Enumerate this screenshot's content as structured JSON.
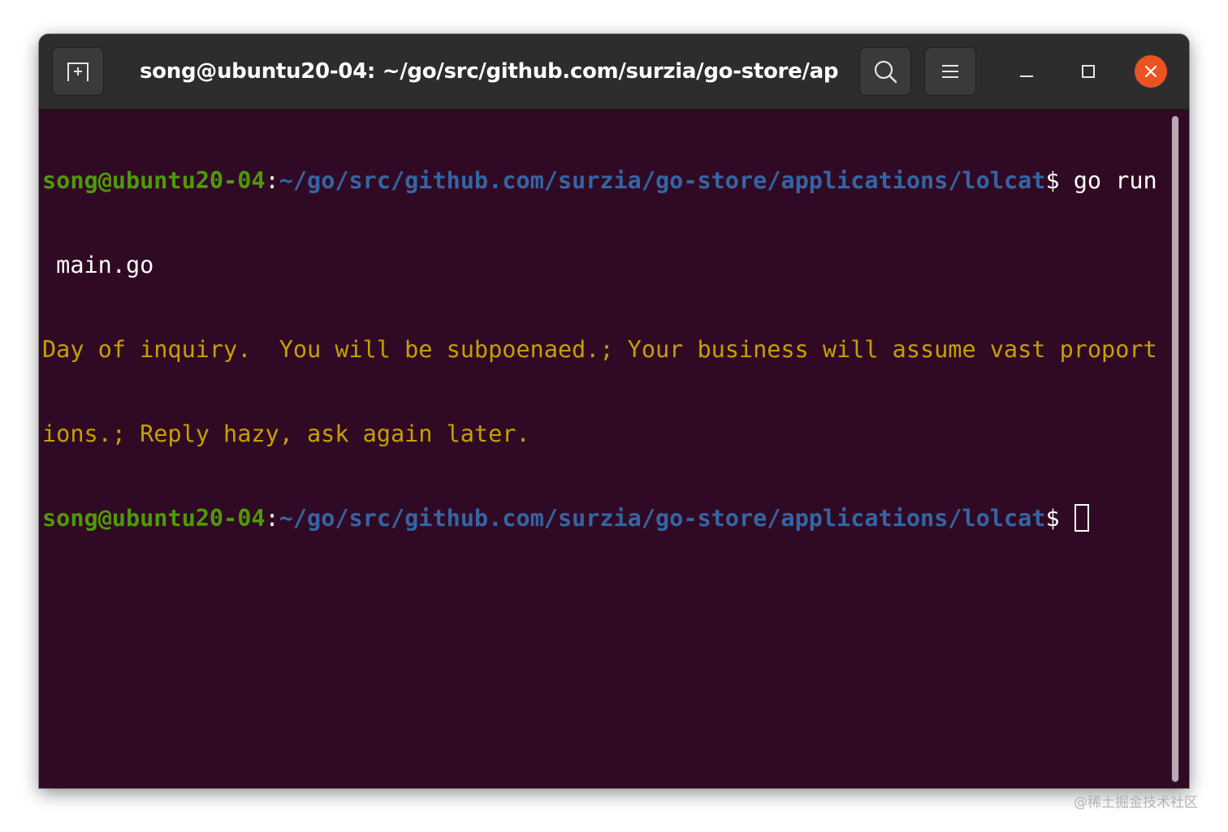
{
  "window": {
    "title": "song@ubuntu20-04: ~/go/src/github.com/surzia/go-store/ap…"
  },
  "icons": {
    "new_tab": "new-tab-icon",
    "search": "search-icon",
    "menu": "hamburger-menu-icon",
    "minimize": "minimize-icon",
    "maximize": "maximize-icon",
    "close": "close-icon"
  },
  "terminal": {
    "prompt_user": "song@ubuntu20-04",
    "prompt_colon": ":",
    "prompt_path": "~/go/src/github.com/surzia/go-store/applications/lolcat",
    "prompt_dollar": "$",
    "command_line1": " go run",
    "command_line2": " main.go",
    "output_line1": "Day of inquiry.  You will be subpoenaed.; Your business will assume vast proport",
    "output_line2": "ions.; Reply hazy, ask again later."
  },
  "colors": {
    "terminal_bg": "#300a24",
    "prompt_user": "#4e9a06",
    "prompt_path": "#3465a4",
    "output_text": "#c4a000",
    "close_button": "#e95420",
    "titlebar": "#2d2d2d"
  },
  "watermark": "@稀土掘金技术社区"
}
